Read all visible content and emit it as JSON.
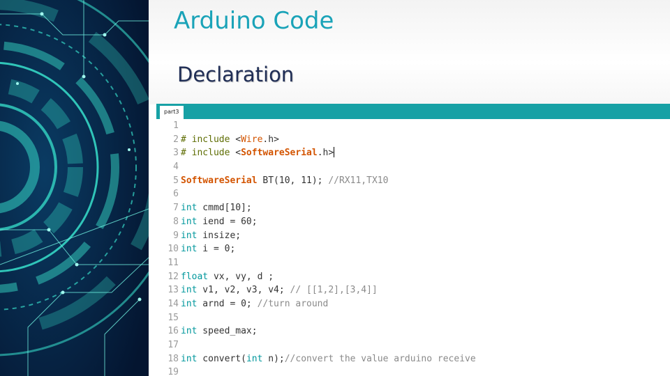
{
  "slide": {
    "title": "Arduino Code",
    "subtitle": "Declaration"
  },
  "editor": {
    "tab_label": "part3",
    "lines": [
      {
        "num": "1",
        "parts": []
      },
      {
        "num": "2",
        "parts": [
          {
            "t": "# include ",
            "c": "inc"
          },
          {
            "t": "<",
            "c": "plain"
          },
          {
            "t": "Wire",
            "c": "clsn"
          },
          {
            "t": ".h>",
            "c": "plain"
          }
        ]
      },
      {
        "num": "3",
        "parts": [
          {
            "t": "# include ",
            "c": "inc"
          },
          {
            "t": "<",
            "c": "plain"
          },
          {
            "t": "SoftwareSerial",
            "c": "cls"
          },
          {
            "t": ".h>",
            "c": "plain"
          }
        ],
        "cursor": true
      },
      {
        "num": "4",
        "parts": []
      },
      {
        "num": "5",
        "parts": [
          {
            "t": "SoftwareSerial",
            "c": "cls"
          },
          {
            "t": " BT(10, 11); ",
            "c": "plain"
          },
          {
            "t": "//RX11,TX10",
            "c": "cm"
          }
        ]
      },
      {
        "num": "6",
        "parts": []
      },
      {
        "num": "7",
        "parts": [
          {
            "t": "int",
            "c": "kw"
          },
          {
            "t": " cmmd[10];",
            "c": "plain"
          }
        ]
      },
      {
        "num": "8",
        "parts": [
          {
            "t": "int",
            "c": "kw"
          },
          {
            "t": " iend = 60;",
            "c": "plain"
          }
        ]
      },
      {
        "num": "9",
        "parts": [
          {
            "t": "int",
            "c": "kw"
          },
          {
            "t": " insize;",
            "c": "plain"
          }
        ]
      },
      {
        "num": "10",
        "parts": [
          {
            "t": "int",
            "c": "kw"
          },
          {
            "t": " i = 0;",
            "c": "plain"
          }
        ]
      },
      {
        "num": "11",
        "parts": []
      },
      {
        "num": "12",
        "parts": [
          {
            "t": "float",
            "c": "kw"
          },
          {
            "t": " vx, vy, d ;",
            "c": "plain"
          }
        ]
      },
      {
        "num": "13",
        "parts": [
          {
            "t": "int",
            "c": "kw"
          },
          {
            "t": " v1, v2, v3, v4; ",
            "c": "plain"
          },
          {
            "t": "// [[1,2],[3,4]]",
            "c": "cm"
          }
        ]
      },
      {
        "num": "14",
        "parts": [
          {
            "t": "int",
            "c": "kw"
          },
          {
            "t": " arnd = 0; ",
            "c": "plain"
          },
          {
            "t": "//turn around",
            "c": "cm"
          }
        ]
      },
      {
        "num": "15",
        "parts": []
      },
      {
        "num": "16",
        "parts": [
          {
            "t": "int",
            "c": "kw"
          },
          {
            "t": " speed_max;",
            "c": "plain"
          }
        ]
      },
      {
        "num": "17",
        "parts": []
      },
      {
        "num": "18",
        "parts": [
          {
            "t": "int",
            "c": "kw"
          },
          {
            "t": " convert(",
            "c": "plain"
          },
          {
            "t": "int",
            "c": "kw"
          },
          {
            "t": " n);",
            "c": "plain"
          },
          {
            "t": "//convert the value arduino receive",
            "c": "cm"
          }
        ]
      },
      {
        "num": "19",
        "parts": []
      }
    ]
  },
  "colors": {
    "title": "#1aa3b8",
    "subtitle": "#1f2d55",
    "tab_bar": "#17a1a5",
    "keyword": "#00979c",
    "class": "#d35400",
    "comment": "#8a8a8a",
    "include": "#5e6d03"
  }
}
